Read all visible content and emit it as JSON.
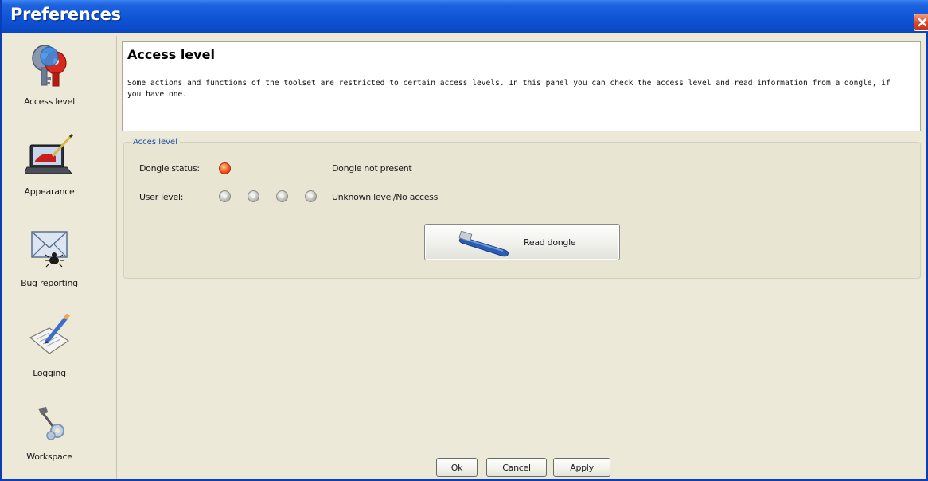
{
  "window": {
    "title": "Preferences"
  },
  "sidebar": {
    "items": [
      {
        "label": "Access level",
        "icon": "keys-icon"
      },
      {
        "label": "Appearance",
        "icon": "laptop-brush-icon"
      },
      {
        "label": "Bug reporting",
        "icon": "envelope-bug-icon"
      },
      {
        "label": "Logging",
        "icon": "notepad-pencil-icon"
      },
      {
        "label": "Workspace",
        "icon": "tools-icon"
      }
    ]
  },
  "header": {
    "title": "Access level",
    "description": "Some actions and functions of the toolset are restricted to certain access levels. In this panel you can check the access level and read information from a dongle, if you have one."
  },
  "access_group": {
    "legend": "Acces level",
    "dongle_status_label": "Dongle status:",
    "dongle_status_value": "Dongle not present",
    "dongle_status_color": "#e8541e",
    "user_level_label": "User level:",
    "user_level_value": "Unknown level/No access",
    "user_level_indicators": 4,
    "read_button_label": "Read dongle"
  },
  "footer": {
    "ok_label": "Ok",
    "cancel_label": "Cancel",
    "apply_label": "Apply"
  },
  "colors": {
    "titlebar": "#0f54d6",
    "accent": "#1b4ca8",
    "background": "#ece9d8"
  }
}
